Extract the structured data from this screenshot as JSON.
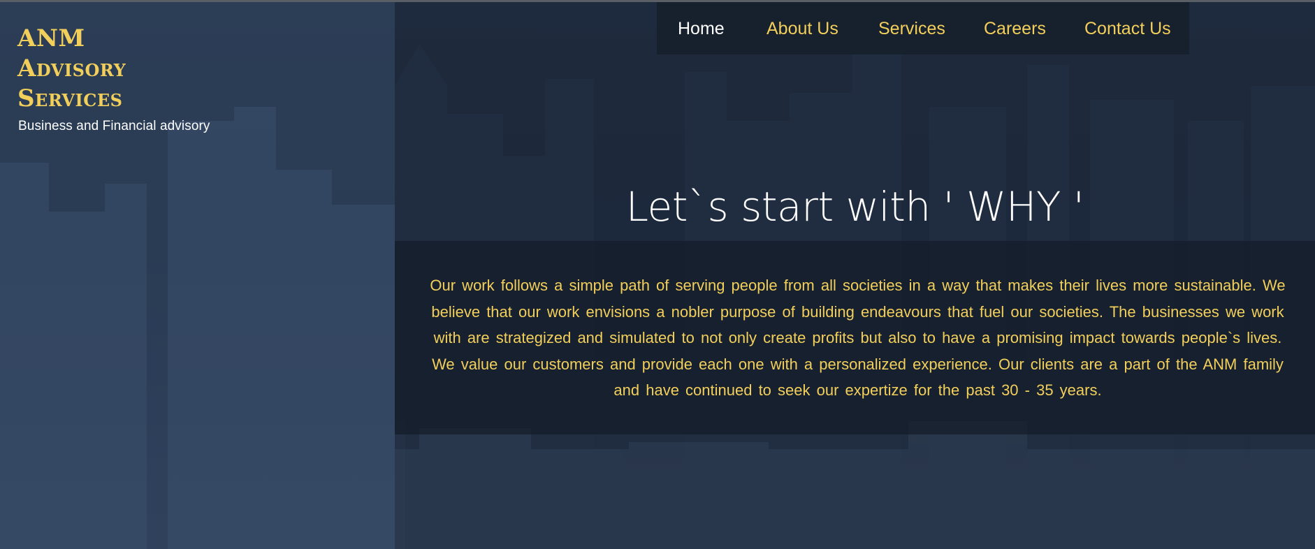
{
  "brand": {
    "line1": "ANM",
    "line2": "Advisory",
    "line3": "Services",
    "tagline": "Business and Financial advisory"
  },
  "nav": {
    "items": [
      {
        "label": "Home",
        "active": true
      },
      {
        "label": "About Us",
        "active": false
      },
      {
        "label": "Services",
        "active": false
      },
      {
        "label": "Careers",
        "active": false
      },
      {
        "label": "Contact Us",
        "active": false
      }
    ]
  },
  "hero": {
    "heading": "Let`s start with ' WHY '",
    "body": "Our work follows a simple path of serving people from all societies in a way that makes their lives more sustainable. We believe that our work envisions a nobler purpose of building endeavours that fuel our societies. The businesses we work with are strategized and simulated to not only create profits but also to have a promising impact towards people`s lives. We value our customers and provide each one with a personalized experience. Our clients are a part of the ANM family and have continued to seek our expertize for the past 30 - 35 years."
  },
  "colors": {
    "accent": "#f2cf5b",
    "background": "#1c2738",
    "nav_background": "#161e2a",
    "text_light": "#ffffff"
  }
}
